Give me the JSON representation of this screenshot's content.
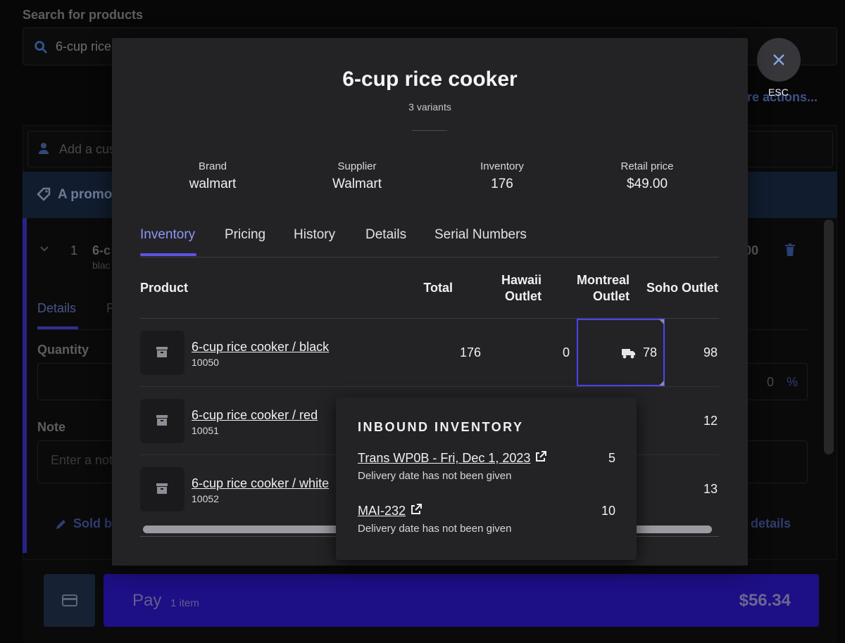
{
  "background": {
    "search_label": "Search for products",
    "search_value": "6-cup rice",
    "more_actions": "ore actions...",
    "customer_placeholder": "Add a cus",
    "promo_text": "A promot",
    "item_qty": "1",
    "item_name": "6-c",
    "item_sub": "blac",
    "item_price": "00",
    "tab_details": "Details",
    "tab_f": "F",
    "quantity_label": "Quantity",
    "discount_value": "0",
    "discount_unit": "%",
    "note_label": "Note",
    "note_placeholder": "Enter a not",
    "sold_by": "Sold by",
    "details_link": "details",
    "pay_label": "Pay",
    "pay_count": "1 item",
    "pay_amount": "$56.34"
  },
  "close": {
    "label": "ESC"
  },
  "modal": {
    "title": "6-cup rice cooker",
    "variants": "3 variants",
    "stats": [
      {
        "key": "Brand",
        "value": "walmart"
      },
      {
        "key": "Supplier",
        "value": "Walmart"
      },
      {
        "key": "Inventory",
        "value": "176"
      },
      {
        "key": "Retail price",
        "value": "$49.00"
      }
    ],
    "tabs": [
      "Inventory",
      "Pricing",
      "History",
      "Details",
      "Serial Numbers"
    ],
    "active_tab": "Inventory",
    "columns": {
      "product": "Product",
      "total": "Total",
      "hawaii_1": "Hawaii",
      "hawaii_2": "Outlet",
      "montreal_1": "Montreal",
      "montreal_2": "Outlet",
      "soho": "Soho Outlet"
    },
    "rows": [
      {
        "name": "6-cup rice cooker / black",
        "sku": "10050",
        "total": "176",
        "hawaii": "0",
        "montreal": "78",
        "soho": "98"
      },
      {
        "name": "6-cup rice cooker / red",
        "sku": "10051",
        "total": "",
        "hawaii": "",
        "montreal": "",
        "soho": "12"
      },
      {
        "name": "6-cup rice cooker / white",
        "sku": "10052",
        "total": "",
        "hawaii": "",
        "montreal": "",
        "soho": "13"
      }
    ]
  },
  "popover": {
    "title": "INBOUND INVENTORY",
    "items": [
      {
        "link": "Trans WP0B - Fri, Dec 1, 2023",
        "qty": "5",
        "sub": "Delivery date has not been given"
      },
      {
        "link": "MAI-232",
        "qty": "10",
        "sub": "Delivery date has not been given"
      }
    ]
  },
  "colors": {
    "accent": "#5b54e6",
    "pay_button": "#2b17c4",
    "modal_bg": "#232326"
  }
}
